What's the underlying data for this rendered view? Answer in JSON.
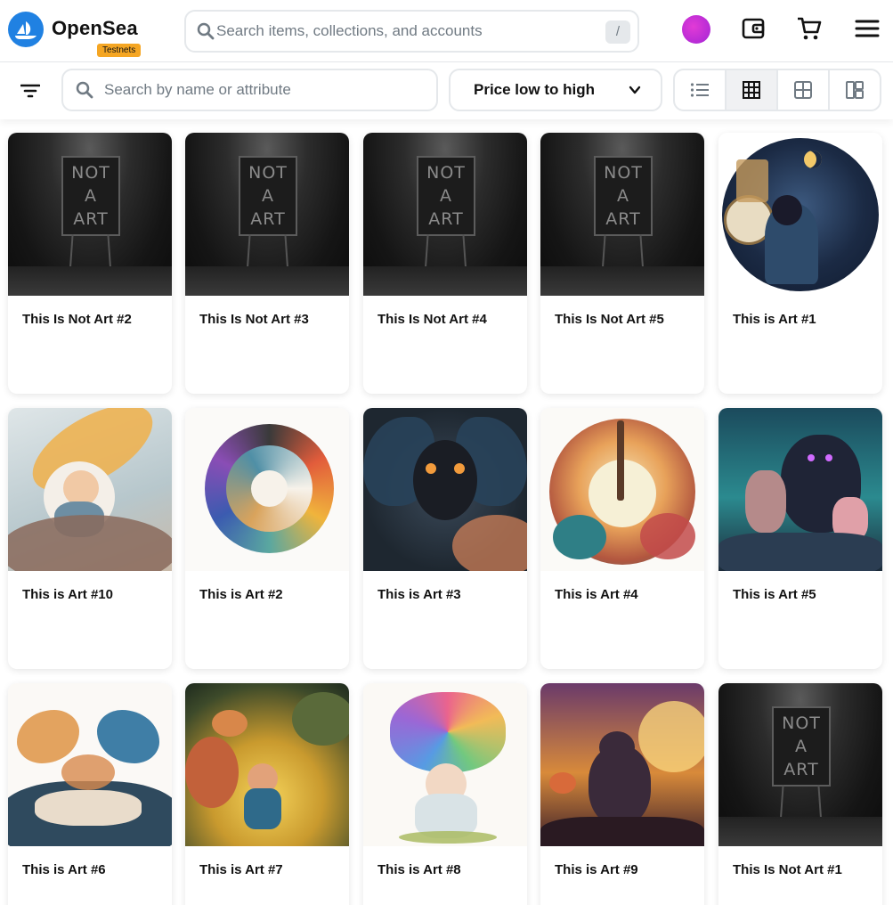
{
  "header": {
    "logo_text": "OpenSea",
    "badge": "Testnets",
    "search_placeholder": "Search items, collections, and accounts",
    "search_shortcut": "/",
    "icons": [
      "opensea-logo-icon",
      "search-icon",
      "avatar",
      "wallet-icon",
      "cart-icon",
      "menu-icon"
    ]
  },
  "toolbar": {
    "attribute_search_placeholder": "Search by name or attribute",
    "sort_label": "Price low to high",
    "view_modes": [
      "list-view",
      "grid-view",
      "large-grid-view",
      "mosaic-view"
    ],
    "active_view": "grid-view"
  },
  "items": [
    {
      "title": "This Is Not Art #2",
      "art": "notart"
    },
    {
      "title": "This Is Not Art #3",
      "art": "notart"
    },
    {
      "title": "This Is Not Art #4",
      "art": "notart"
    },
    {
      "title": "This Is Not Art #5",
      "art": "notart"
    },
    {
      "title": "This is Art #1",
      "art": "night-boy"
    },
    {
      "title": "This is Art #10",
      "art": "baby-clouds"
    },
    {
      "title": "This is Art #2",
      "art": "spiral"
    },
    {
      "title": "This is Art #3",
      "art": "moth-creature"
    },
    {
      "title": "This is Art #4",
      "art": "tree-circle"
    },
    {
      "title": "This is Art #5",
      "art": "deer-forest"
    },
    {
      "title": "This is Art #6",
      "art": "butterflies"
    },
    {
      "title": "This is Art #7",
      "art": "kid-forest"
    },
    {
      "title": "This is Art #8",
      "art": "baby-rainbow"
    },
    {
      "title": "This is Art #9",
      "art": "cat-forest"
    },
    {
      "title": "This Is Not Art #1",
      "art": "notart"
    }
  ],
  "colors": {
    "brand_blue": "#2081e2",
    "badge_orange": "#f5a623",
    "border": "#e5e8eb",
    "text_primary": "#121212",
    "text_muted": "#707a83"
  }
}
